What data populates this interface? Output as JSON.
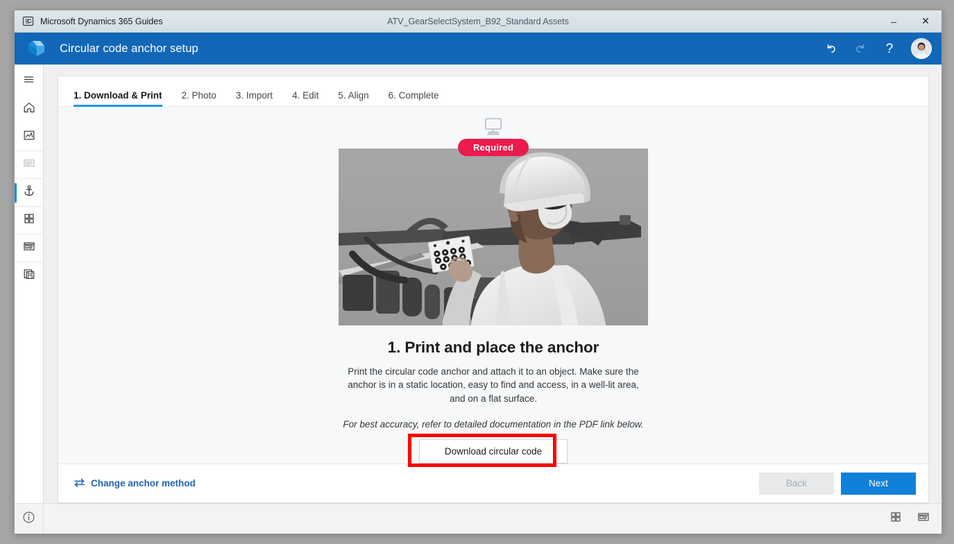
{
  "titlebar": {
    "app_name": "Microsoft Dynamics 365 Guides",
    "document_name": "ATV_GearSelectSystem_B92_Standard Assets",
    "app_icon": "dynamics-guides-icon",
    "minimize_label": "–",
    "close_label": "✕"
  },
  "appbar": {
    "title": "Circular code anchor setup",
    "logo_icon": "guides-logo-icon",
    "undo_icon": "undo-arrow-icon",
    "redo_icon": "redo-arrow-icon",
    "help_label": "?",
    "avatar_icon": "user-avatar",
    "accent_color": "#1267b8"
  },
  "sidebar": {
    "items": [
      {
        "name": "menu-hamburger",
        "icon": "hamburger-icon",
        "state": "normal"
      },
      {
        "name": "home",
        "icon": "home-icon",
        "state": "normal"
      },
      {
        "name": "analytics",
        "icon": "chart-image-icon",
        "state": "normal"
      },
      {
        "name": "outline",
        "icon": "document-lines-icon",
        "state": "disabled"
      },
      {
        "name": "anchor",
        "icon": "anchor-icon",
        "state": "active"
      },
      {
        "name": "steps-grid",
        "icon": "grid-four-squares-icon",
        "state": "normal"
      },
      {
        "name": "step-card",
        "icon": "card-panel-icon",
        "state": "normal"
      },
      {
        "name": "save",
        "icon": "save-copy-icon",
        "state": "normal"
      }
    ]
  },
  "card": {
    "tabs": [
      {
        "label": "1. Download & Print",
        "active": true
      },
      {
        "label": "2. Photo",
        "active": false
      },
      {
        "label": "3. Import",
        "active": false
      },
      {
        "label": "4. Edit",
        "active": false
      },
      {
        "label": "5. Align",
        "active": false
      },
      {
        "label": "6. Complete",
        "active": false
      }
    ],
    "device_icon": "desktop-monitor-icon",
    "badge": {
      "label": "Required",
      "color": "#ea1b4d"
    },
    "hero_image_alt": "worker-placing-circular-code-anchor",
    "step_title": "1. Print and place the anchor",
    "step_description": "Print the circular code anchor and attach it to an object. Make sure the anchor is in a static location, easy to find and access, in a well-lit area, and on a flat surface.",
    "step_note": "For best accuracy, refer to detailed documentation in the PDF link below.",
    "download_button": "Download circular code",
    "annotation_color": "#fe0000"
  },
  "footer": {
    "change_method_label": "Change anchor method",
    "change_method_icon": "swap-arrows-icon",
    "back_label": "Back",
    "back_disabled": true,
    "next_label": "Next",
    "next_color": "#1080d8"
  },
  "statusbar": {
    "info_icon": "info-circle-icon",
    "grid_view_icon": "grid-four-squares-icon",
    "card_view_icon": "card-panel-icon"
  }
}
